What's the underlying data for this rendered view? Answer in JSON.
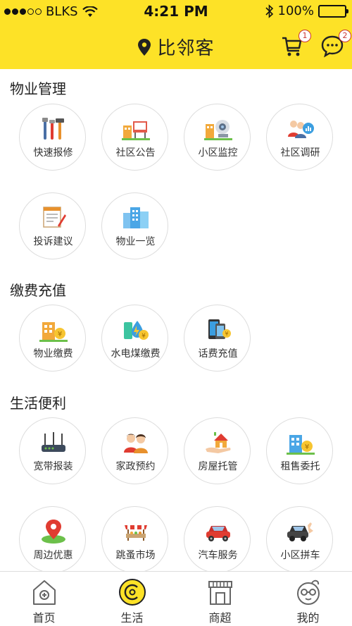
{
  "status": {
    "carrier": "BLKS",
    "time": "4:21 PM",
    "battery": "100%"
  },
  "header": {
    "title": "比邻客",
    "cart_badge": "1",
    "chat_badge": "2"
  },
  "sections": [
    {
      "title": "物业管理",
      "items": [
        "快速报修",
        "社区公告",
        "小区监控",
        "社区调研",
        "投诉建议",
        "物业一览"
      ]
    },
    {
      "title": "缴费充值",
      "items": [
        "物业缴费",
        "水电煤缴费",
        "话费充值"
      ]
    },
    {
      "title": "生活便利",
      "items": [
        "宽带报装",
        "家政预约",
        "房屋托管",
        "租售委托",
        "周边优惠",
        "跳蚤市场",
        "汽车服务",
        "小区拼车"
      ]
    }
  ],
  "tabs": [
    {
      "label": "首页",
      "icon": "home-icon"
    },
    {
      "label": "生活",
      "icon": "life-icon",
      "active": true
    },
    {
      "label": "商超",
      "icon": "store-icon"
    },
    {
      "label": "我的",
      "icon": "profile-icon"
    }
  ],
  "colors": {
    "accent": "#fde227",
    "badge": "#cc3333"
  }
}
